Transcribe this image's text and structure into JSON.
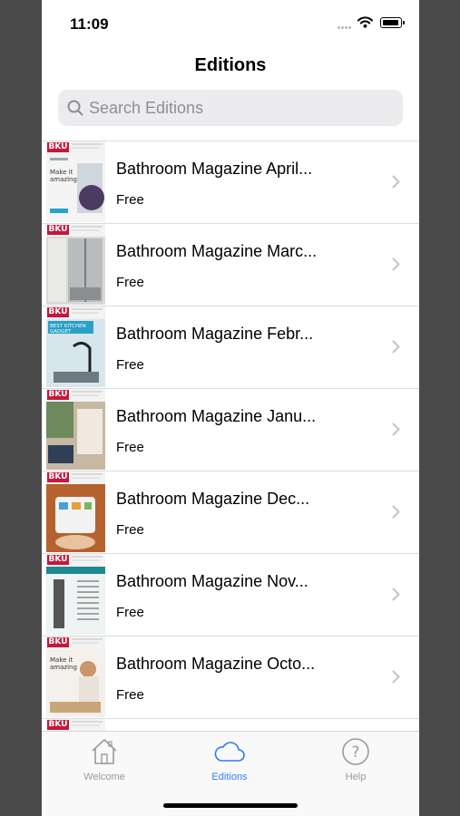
{
  "status_bar": {
    "time": "11:09"
  },
  "nav": {
    "title": "Editions"
  },
  "search": {
    "placeholder": "Search Editions"
  },
  "thumbnail_logo": "BKU",
  "editions": [
    {
      "title": "Bathroom Magazine April...",
      "price": "Free"
    },
    {
      "title": "Bathroom Magazine Marc...",
      "price": "Free"
    },
    {
      "title": "Bathroom Magazine Febr...",
      "price": "Free"
    },
    {
      "title": "Bathroom Magazine Janu...",
      "price": "Free"
    },
    {
      "title": "Bathroom Magazine Dec...",
      "price": "Free"
    },
    {
      "title": "Bathroom Magazine Nov...",
      "price": "Free"
    },
    {
      "title": "Bathroom Magazine Octo...",
      "price": "Free"
    },
    {
      "title": "",
      "price": ""
    }
  ],
  "tabs": {
    "welcome": {
      "label": "Welcome",
      "icon": "house-icon"
    },
    "editions": {
      "label": "Editions",
      "icon": "cloud-icon",
      "selected": true
    },
    "help": {
      "label": "Help",
      "icon": "question-circle-icon"
    }
  },
  "colors": {
    "accent": "#2f7cf6",
    "inactive_tab": "#9a9a9a",
    "logo_red": "#c4183c"
  }
}
